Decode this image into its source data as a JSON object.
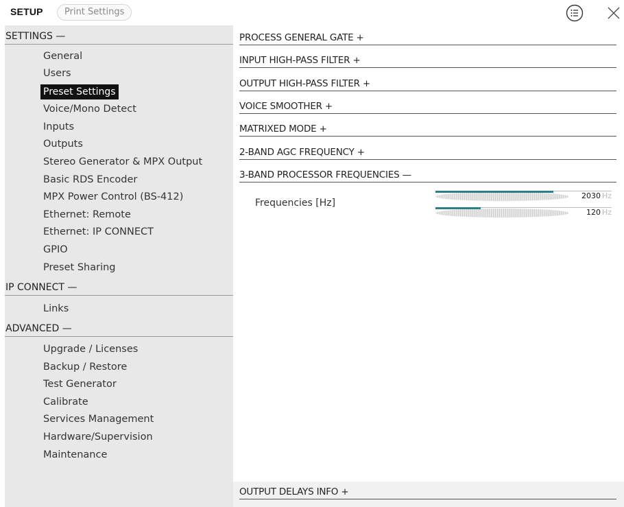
{
  "header": {
    "title": "SETUP",
    "print_button": "Print Settings",
    "list_icon": "list-icon",
    "close_icon": "close-icon"
  },
  "sidebar": {
    "sections": [
      {
        "label": "SETTINGS —",
        "items": [
          "General",
          "Users",
          "Preset Settings",
          "Voice/Mono Detect",
          "Inputs",
          "Outputs",
          "Stereo Generator & MPX Output",
          "Basic RDS Encoder",
          "MPX Power Control (BS-412)",
          "Ethernet: Remote",
          "Ethernet: IP CONNECT",
          "GPIO",
          "Preset Sharing"
        ]
      },
      {
        "label": "IP CONNECT —",
        "items": [
          "Links"
        ]
      },
      {
        "label": "ADVANCED —",
        "items": [
          "Upgrade / Licenses",
          "Backup / Restore",
          "Test Generator",
          "Calibrate",
          "Services Management",
          "Hardware/Supervision",
          "Maintenance"
        ]
      }
    ],
    "active_item": "Preset Settings"
  },
  "main": {
    "sections": [
      "PROCESS GENERAL GATE  +",
      "INPUT HIGH-PASS FILTER  +",
      "OUTPUT HIGH-PASS FILTER  +",
      "VOICE SMOOTHER  +",
      "MATRIXED MODE  +",
      "2-BAND AGC FREQUENCY  +",
      "3-BAND PROCESSOR FREQUENCIES  —"
    ],
    "frequencies": {
      "label": "Frequencies [Hz]",
      "unit": "Hz",
      "sliders": [
        {
          "value": "2030",
          "fill_fraction": 0.88
        },
        {
          "value": "120",
          "fill_fraction": 0.34
        }
      ]
    },
    "bottom_section": "OUTPUT DELAYS INFO  +"
  },
  "colors": {
    "accent": "#2d7f86",
    "sidebar_bg": "#e8e8e8",
    "active_bg": "#111111"
  }
}
